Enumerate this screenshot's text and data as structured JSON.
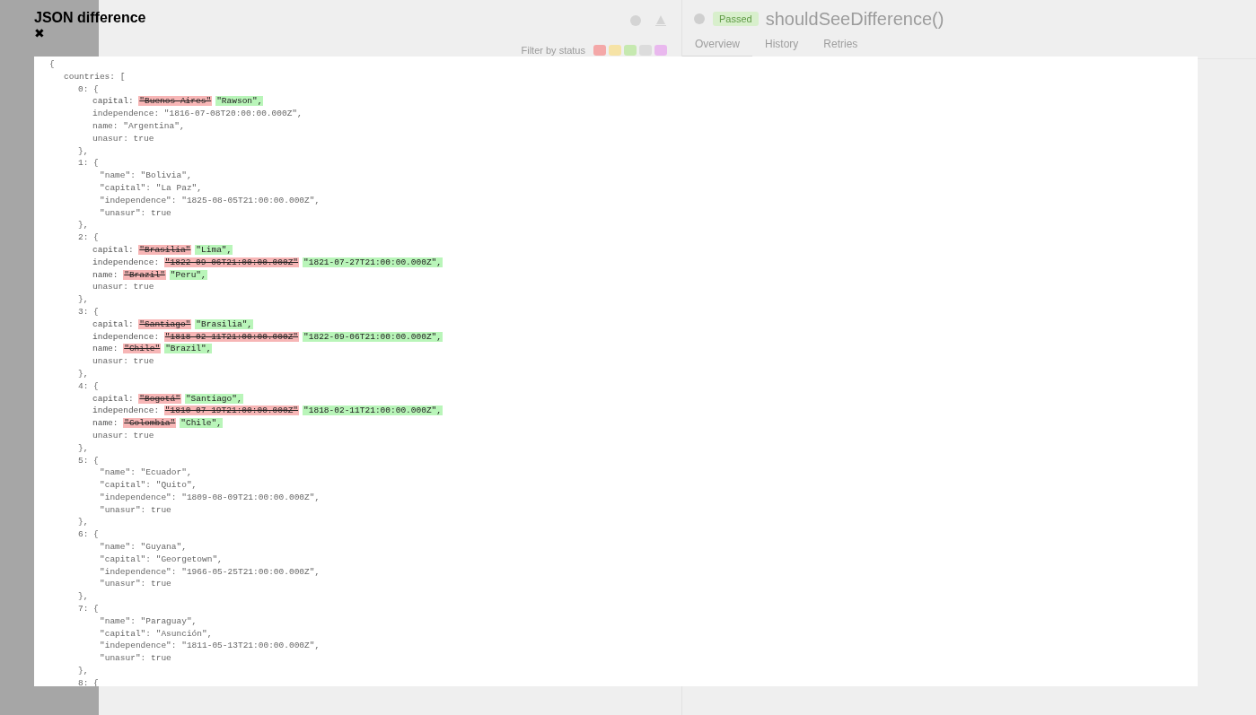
{
  "background": {
    "suites": {
      "filter_label": "Filter by status",
      "status_filters": [
        {
          "color": "#f4a8a8"
        },
        {
          "color": "#f6e3a6"
        },
        {
          "color": "#c6e9b0"
        },
        {
          "color": "#dcdcdc"
        },
        {
          "color": "#e9b8ee"
        }
      ]
    },
    "test": {
      "status": "Passed",
      "title": "shouldSeeDifference()",
      "tabs": [
        {
          "label": "Overview",
          "selected": true
        },
        {
          "label": "History",
          "selected": false
        },
        {
          "label": "Retries",
          "selected": false
        }
      ]
    }
  },
  "modal": {
    "title": "JSON difference",
    "close": "✖",
    "diff": {
      "open": "{",
      "array_open": "countries: [",
      "items": [
        {
          "open": "0: {",
          "close": "},",
          "fields": [
            {
              "kind": "changed",
              "key": "capital: ",
              "old": "\"Buenos Aires\"",
              "new": "\"Rawson\","
            },
            {
              "kind": "same",
              "text": "independence: \"1816-07-08T20:00:00.000Z\","
            },
            {
              "kind": "same",
              "text": "name: \"Argentina\","
            },
            {
              "kind": "same",
              "text": "unasur: true"
            }
          ]
        },
        {
          "open": "1: {",
          "close": "},",
          "fields": [
            {
              "kind": "raw",
              "text": "\"name\": \"Bolivia\","
            },
            {
              "kind": "raw",
              "text": "\"capital\": \"La Paz\","
            },
            {
              "kind": "raw",
              "text": "\"independence\": \"1825-08-05T21:00:00.000Z\","
            },
            {
              "kind": "raw",
              "text": "\"unasur\": true"
            }
          ]
        },
        {
          "open": "2: {",
          "close": "},",
          "fields": [
            {
              "kind": "changed",
              "key": "capital: ",
              "old": "\"Brasilia\"",
              "new": "\"Lima\","
            },
            {
              "kind": "changed",
              "key": "independence: ",
              "old": "\"1822-09-06T21:00:00.000Z\"",
              "new": "\"1821-07-27T21:00:00.000Z\","
            },
            {
              "kind": "changed",
              "key": "name: ",
              "old": "\"Brazil\"",
              "new": "\"Peru\","
            },
            {
              "kind": "same",
              "text": "unasur: true"
            }
          ]
        },
        {
          "open": "3: {",
          "close": "},",
          "fields": [
            {
              "kind": "changed",
              "key": "capital: ",
              "old": "\"Santiago\"",
              "new": "\"Brasilia\","
            },
            {
              "kind": "changed",
              "key": "independence: ",
              "old": "\"1818-02-11T21:00:00.000Z\"",
              "new": "\"1822-09-06T21:00:00.000Z\","
            },
            {
              "kind": "changed",
              "key": "name: ",
              "old": "\"Chile\"",
              "new": "\"Brazil\","
            },
            {
              "kind": "same",
              "text": "unasur: true"
            }
          ]
        },
        {
          "open": "4: {",
          "close": "},",
          "fields": [
            {
              "kind": "changed",
              "key": "capital: ",
              "old": "\"Bogotá\"",
              "new": "\"Santiago\","
            },
            {
              "kind": "changed",
              "key": "independence: ",
              "old": "\"1810-07-19T21:00:00.000Z\"",
              "new": "\"1818-02-11T21:00:00.000Z\","
            },
            {
              "kind": "changed",
              "key": "name: ",
              "old": "\"Colombia\"",
              "new": "\"Chile\","
            },
            {
              "kind": "same",
              "text": "unasur: true"
            }
          ]
        },
        {
          "open": "5: {",
          "close": "},",
          "fields": [
            {
              "kind": "raw",
              "text": "\"name\": \"Ecuador\","
            },
            {
              "kind": "raw",
              "text": "\"capital\": \"Quito\","
            },
            {
              "kind": "raw",
              "text": "\"independence\": \"1809-08-09T21:00:00.000Z\","
            },
            {
              "kind": "raw",
              "text": "\"unasur\": true"
            }
          ]
        },
        {
          "open": "6: {",
          "close": "},",
          "fields": [
            {
              "kind": "raw",
              "text": "\"name\": \"Guyana\","
            },
            {
              "kind": "raw",
              "text": "\"capital\": \"Georgetown\","
            },
            {
              "kind": "raw",
              "text": "\"independence\": \"1966-05-25T21:00:00.000Z\","
            },
            {
              "kind": "raw",
              "text": "\"unasur\": true"
            }
          ]
        },
        {
          "open": "7: {",
          "close": "},",
          "fields": [
            {
              "kind": "raw",
              "text": "\"name\": \"Paraguay\","
            },
            {
              "kind": "raw",
              "text": "\"capital\": \"Asunción\","
            },
            {
              "kind": "raw",
              "text": "\"independence\": \"1811-05-13T21:00:00.000Z\","
            },
            {
              "kind": "raw",
              "text": "\"unasur\": true"
            }
          ]
        },
        {
          "open": "8: {"
        }
      ]
    }
  }
}
